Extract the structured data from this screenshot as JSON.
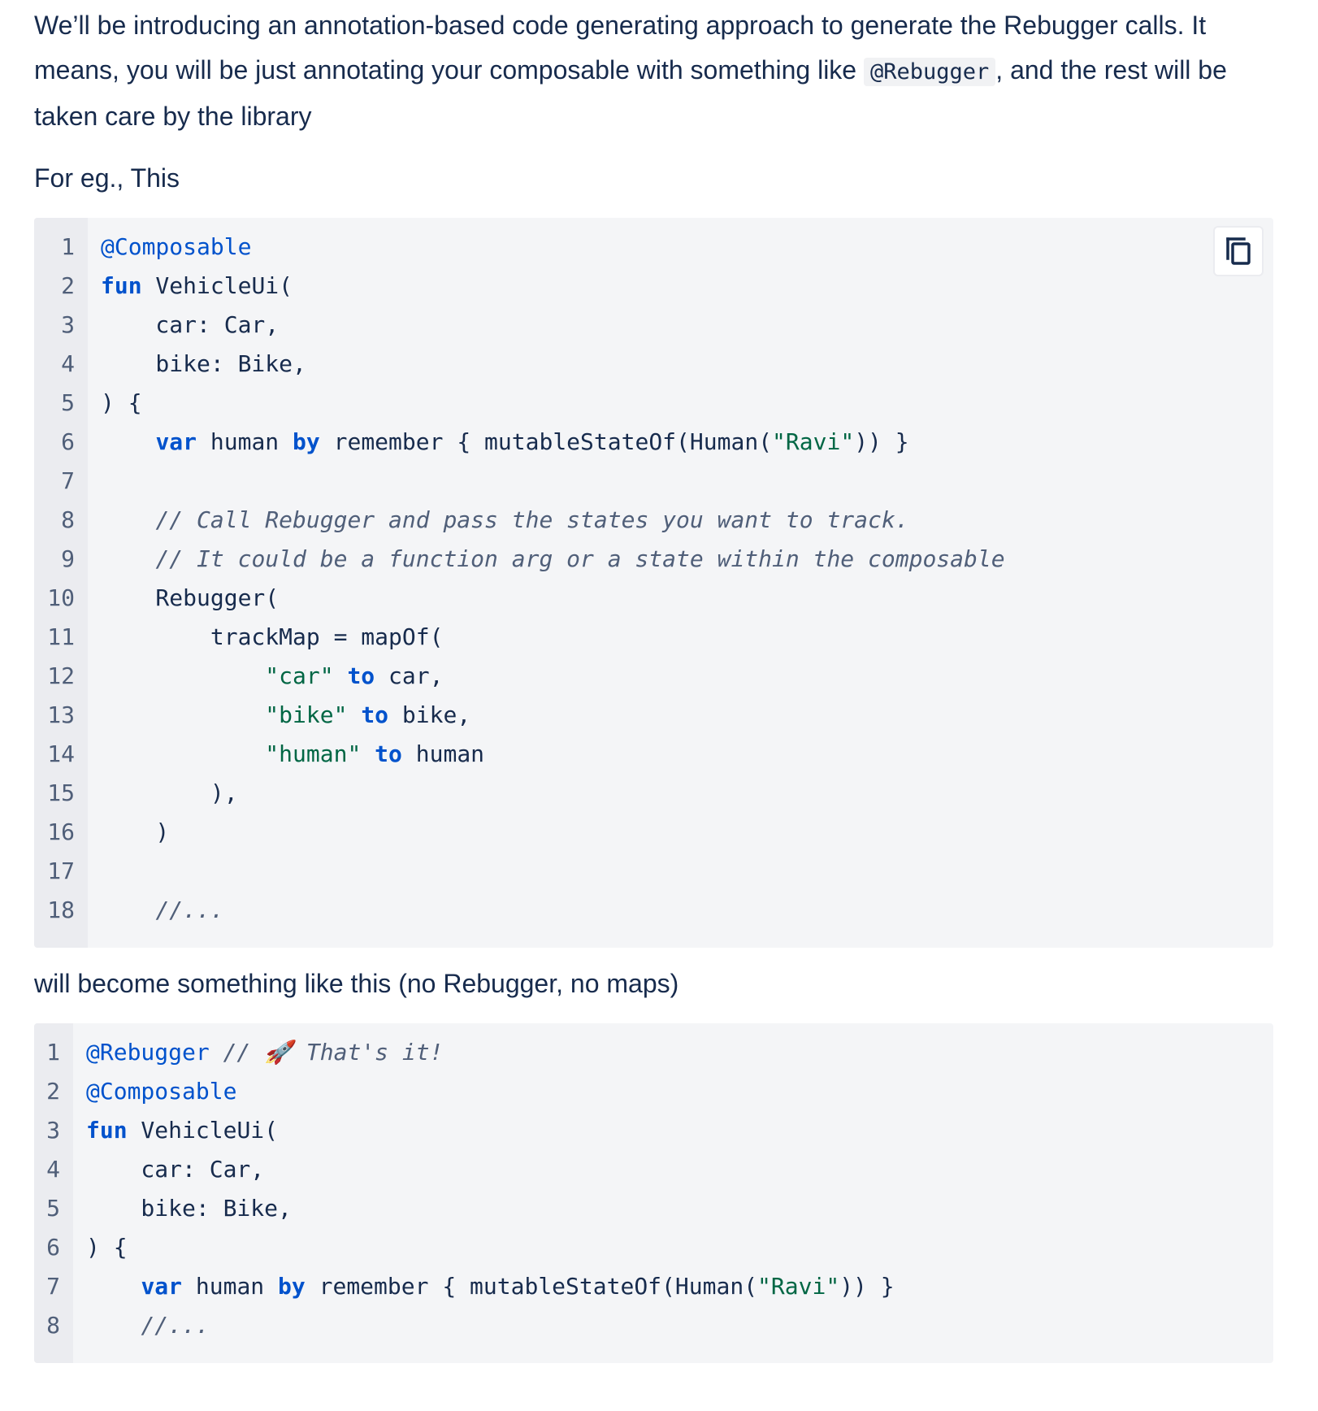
{
  "paragraphs": {
    "intro_before": "We’ll be introducing an annotation-based code generating approach to generate the Rebugger calls. It means, you will be just annotating your composable with something like ",
    "intro_code": "@Rebugger",
    "intro_after": ", and the rest will be taken care by the library",
    "example": "For eg., This",
    "transition": "will become something like this (no Rebugger, no maps)"
  },
  "code_block_1": {
    "line_numbers": [
      "1",
      "2",
      "3",
      "4",
      "5",
      "6",
      "7",
      "8",
      "9",
      "10",
      "11",
      "12",
      "13",
      "14",
      "15",
      "16",
      "17",
      "18"
    ],
    "copy_icon": "copy-icon",
    "lines": [
      [
        {
          "t": "ann",
          "v": "@Composable"
        }
      ],
      [
        {
          "t": "kw",
          "v": "fun"
        },
        {
          "t": "pl",
          "v": " VehicleUi("
        }
      ],
      [
        {
          "t": "pl",
          "v": "    car: Car,"
        }
      ],
      [
        {
          "t": "pl",
          "v": "    bike: Bike,"
        }
      ],
      [
        {
          "t": "pl",
          "v": ") {"
        }
      ],
      [
        {
          "t": "pl",
          "v": "    "
        },
        {
          "t": "kw",
          "v": "var"
        },
        {
          "t": "pl",
          "v": " human "
        },
        {
          "t": "kw",
          "v": "by"
        },
        {
          "t": "pl",
          "v": " remember { mutableStateOf(Human("
        },
        {
          "t": "str",
          "v": "\"Ravi\""
        },
        {
          "t": "pl",
          "v": ")) }"
        }
      ],
      [
        {
          "t": "pl",
          "v": ""
        }
      ],
      [
        {
          "t": "pl",
          "v": "    "
        },
        {
          "t": "cm",
          "v": "// Call Rebugger and pass the states you want to track."
        }
      ],
      [
        {
          "t": "pl",
          "v": "    "
        },
        {
          "t": "cm",
          "v": "// It could be a function arg or a state within the composable"
        }
      ],
      [
        {
          "t": "pl",
          "v": "    Rebugger("
        }
      ],
      [
        {
          "t": "pl",
          "v": "        trackMap = mapOf("
        }
      ],
      [
        {
          "t": "pl",
          "v": "            "
        },
        {
          "t": "str",
          "v": "\"car\""
        },
        {
          "t": "pl",
          "v": " "
        },
        {
          "t": "kw",
          "v": "to"
        },
        {
          "t": "pl",
          "v": " car,"
        }
      ],
      [
        {
          "t": "pl",
          "v": "            "
        },
        {
          "t": "str",
          "v": "\"bike\""
        },
        {
          "t": "pl",
          "v": " "
        },
        {
          "t": "kw",
          "v": "to"
        },
        {
          "t": "pl",
          "v": " bike,"
        }
      ],
      [
        {
          "t": "pl",
          "v": "            "
        },
        {
          "t": "str",
          "v": "\"human\""
        },
        {
          "t": "pl",
          "v": " "
        },
        {
          "t": "kw",
          "v": "to"
        },
        {
          "t": "pl",
          "v": " human"
        }
      ],
      [
        {
          "t": "pl",
          "v": "        ),"
        }
      ],
      [
        {
          "t": "pl",
          "v": "    )"
        }
      ],
      [
        {
          "t": "pl",
          "v": ""
        }
      ],
      [
        {
          "t": "pl",
          "v": "    "
        },
        {
          "t": "cm",
          "v": "//..."
        }
      ]
    ]
  },
  "code_block_2": {
    "line_numbers": [
      "1",
      "2",
      "3",
      "4",
      "5",
      "6",
      "7",
      "8"
    ],
    "lines": [
      [
        {
          "t": "ann",
          "v": "@Rebugger"
        },
        {
          "t": "pl",
          "v": " "
        },
        {
          "t": "cm",
          "v": "// 🚀 That's it!"
        }
      ],
      [
        {
          "t": "ann",
          "v": "@Composable"
        }
      ],
      [
        {
          "t": "kw",
          "v": "fun"
        },
        {
          "t": "pl",
          "v": " VehicleUi("
        }
      ],
      [
        {
          "t": "pl",
          "v": "    car: Car,"
        }
      ],
      [
        {
          "t": "pl",
          "v": "    bike: Bike,"
        }
      ],
      [
        {
          "t": "pl",
          "v": ") {"
        }
      ],
      [
        {
          "t": "pl",
          "v": "    "
        },
        {
          "t": "kw",
          "v": "var"
        },
        {
          "t": "pl",
          "v": " human "
        },
        {
          "t": "kw",
          "v": "by"
        },
        {
          "t": "pl",
          "v": " remember { mutableStateOf(Human("
        },
        {
          "t": "str",
          "v": "\"Ravi\""
        },
        {
          "t": "pl",
          "v": ")) }"
        }
      ],
      [
        {
          "t": "pl",
          "v": "    "
        },
        {
          "t": "cm",
          "v": "//..."
        }
      ]
    ]
  },
  "colors": {
    "text": "#172b4d",
    "keyword": "#0052cc",
    "string": "#006644",
    "comment": "#505f79",
    "code_bg": "#f4f5f7",
    "gutter_bg": "#ebecf0"
  }
}
